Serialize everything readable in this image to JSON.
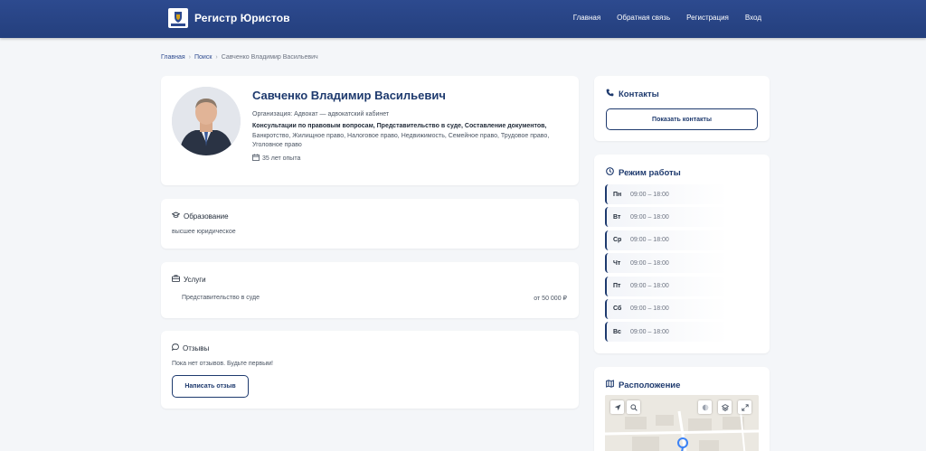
{
  "header": {
    "brand": "Регистр Юристов",
    "nav": [
      "Главная",
      "Обратная связь",
      "Регистрация",
      "Вход"
    ]
  },
  "breadcrumb": {
    "home": "Главная",
    "search": "Поиск",
    "current": "Савченко Владимир Васильевич"
  },
  "profile": {
    "name": "Савченко Владимир Васильевич",
    "organization": "Организация: Адвокат — адвокатский кабинет",
    "specialization_bold": "Консультации по правовым вопросам, Представительство в суде, Составление документов,",
    "specialization_rest": " Банкротство, Жилищное право, Налоговое право, Недвижимость, Семейное право, Трудовое право, Уголовное право",
    "experience": "35 лет опыта"
  },
  "education": {
    "title": "Образование",
    "text": "высшее юридическое"
  },
  "services": {
    "title": "Услуги",
    "items": [
      {
        "name": "Представительство в суде",
        "price": "от 50 000 ₽"
      }
    ]
  },
  "reviews": {
    "title": "Отзывы",
    "empty_text": "Пока нет отзывов. Будьте первым!",
    "write_button": "Написать отзыв"
  },
  "contacts": {
    "title": "Контакты",
    "show_button": "Показать контакты"
  },
  "schedule": {
    "title": "Режим работы",
    "days": [
      {
        "day": "Пн",
        "hours": "09:00 – 18:00"
      },
      {
        "day": "Вт",
        "hours": "09:00 – 18:00"
      },
      {
        "day": "Ср",
        "hours": "09:00 – 18:00"
      },
      {
        "day": "Чт",
        "hours": "09:00 – 18:00"
      },
      {
        "day": "Пт",
        "hours": "09:00 – 18:00"
      },
      {
        "day": "Сб",
        "hours": "09:00 – 18:00"
      },
      {
        "day": "Вс",
        "hours": "09:00 – 18:00"
      }
    ]
  },
  "location": {
    "title": "Расположение"
  },
  "colors": {
    "header_bg": "#2d4a8f",
    "accent": "#1e3a6e",
    "page_bg": "#f4f6f9"
  }
}
